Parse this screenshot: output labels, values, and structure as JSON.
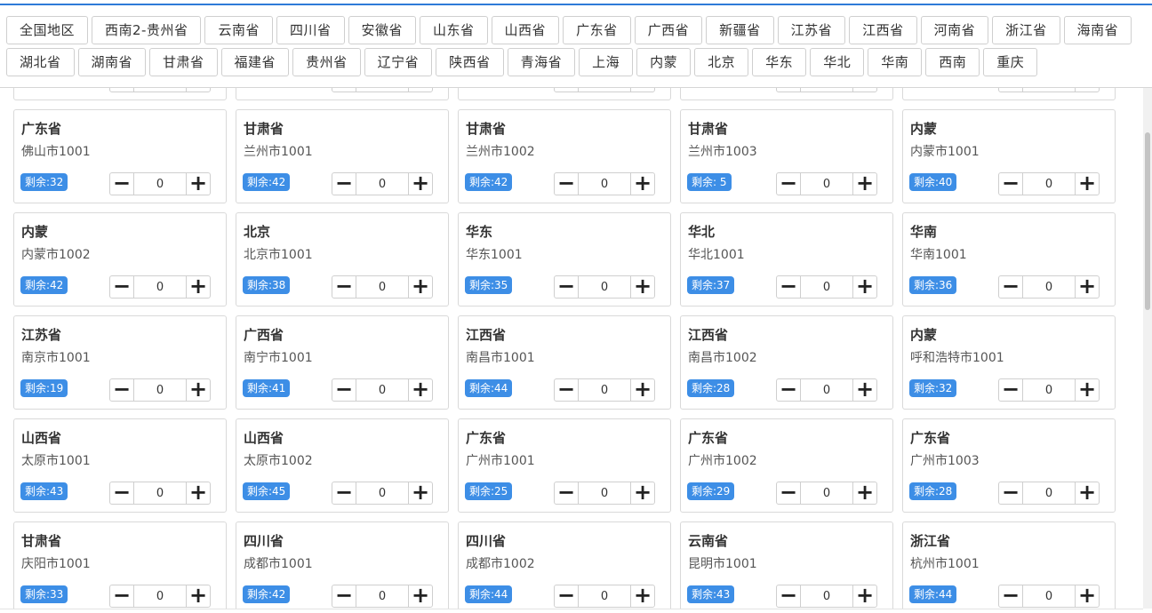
{
  "filters": {
    "row1": [
      "全国地区",
      "西南2-贵州省",
      "云南省",
      "四川省",
      "安徽省",
      "山东省",
      "山西省",
      "广东省",
      "广西省",
      "新疆省",
      "江苏省",
      "江西省",
      "河南省",
      "浙江省",
      "海南省"
    ],
    "row2": [
      "湖北省",
      "湖南省",
      "甘肃省",
      "福建省",
      "贵州省",
      "辽宁省",
      "陕西省",
      "青海省",
      "上海",
      "内蒙",
      "北京",
      "华东",
      "华北",
      "华南",
      "西南",
      "重庆"
    ]
  },
  "remaining_label": "剩余:",
  "cards": [
    {
      "province": "",
      "city": "",
      "remaining": "",
      "qty": "0"
    },
    {
      "province": "",
      "city": "",
      "remaining": "",
      "qty": "0"
    },
    {
      "province": "",
      "city": "",
      "remaining": "",
      "qty": "0"
    },
    {
      "province": "",
      "city": "",
      "remaining": "",
      "qty": "0"
    },
    {
      "province": "",
      "city": "",
      "remaining": "",
      "qty": "0"
    },
    {
      "province": "广东省",
      "city": "佛山市1001",
      "remaining": "剩余:32",
      "qty": "0"
    },
    {
      "province": "甘肃省",
      "city": "兰州市1001",
      "remaining": "剩余:42",
      "qty": "0"
    },
    {
      "province": "甘肃省",
      "city": "兰州市1002",
      "remaining": "剩余:42",
      "qty": "0"
    },
    {
      "province": "甘肃省",
      "city": "兰州市1003",
      "remaining": "剩余: 5",
      "qty": "0"
    },
    {
      "province": "内蒙",
      "city": "内蒙市1001",
      "remaining": "剩余:40",
      "qty": "0"
    },
    {
      "province": "内蒙",
      "city": "内蒙市1002",
      "remaining": "剩余:42",
      "qty": "0"
    },
    {
      "province": "北京",
      "city": "北京市1001",
      "remaining": "剩余:38",
      "qty": "0"
    },
    {
      "province": "华东",
      "city": "华东1001",
      "remaining": "剩余:35",
      "qty": "0"
    },
    {
      "province": "华北",
      "city": "华北1001",
      "remaining": "剩余:37",
      "qty": "0"
    },
    {
      "province": "华南",
      "city": "华南1001",
      "remaining": "剩余:36",
      "qty": "0"
    },
    {
      "province": "江苏省",
      "city": "南京市1001",
      "remaining": "剩余:19",
      "qty": "0"
    },
    {
      "province": "广西省",
      "city": "南宁市1001",
      "remaining": "剩余:41",
      "qty": "0"
    },
    {
      "province": "江西省",
      "city": "南昌市1001",
      "remaining": "剩余:44",
      "qty": "0"
    },
    {
      "province": "江西省",
      "city": "南昌市1002",
      "remaining": "剩余:28",
      "qty": "0"
    },
    {
      "province": "内蒙",
      "city": "呼和浩特市1001",
      "remaining": "剩余:32",
      "qty": "0"
    },
    {
      "province": "山西省",
      "city": "太原市1001",
      "remaining": "剩余:43",
      "qty": "0"
    },
    {
      "province": "山西省",
      "city": "太原市1002",
      "remaining": "剩余:45",
      "qty": "0"
    },
    {
      "province": "广东省",
      "city": "广州市1001",
      "remaining": "剩余:25",
      "qty": "0"
    },
    {
      "province": "广东省",
      "city": "广州市1002",
      "remaining": "剩余:29",
      "qty": "0"
    },
    {
      "province": "广东省",
      "city": "广州市1003",
      "remaining": "剩余:28",
      "qty": "0"
    },
    {
      "province": "甘肃省",
      "city": "庆阳市1001",
      "remaining": "剩余:33",
      "qty": "0"
    },
    {
      "province": "四川省",
      "city": "成都市1001",
      "remaining": "剩余:42",
      "qty": "0"
    },
    {
      "province": "四川省",
      "city": "成都市1002",
      "remaining": "剩余:44",
      "qty": "0"
    },
    {
      "province": "云南省",
      "city": "昆明市1001",
      "remaining": "剩余:43",
      "qty": "0"
    },
    {
      "province": "浙江省",
      "city": "杭州市1001",
      "remaining": "剩余:44",
      "qty": "0"
    }
  ],
  "icons": {
    "minus": "minus-icon",
    "plus": "plus-icon"
  },
  "colors": {
    "accent": "#2f7bd8",
    "badge": "#3d8ee6"
  }
}
